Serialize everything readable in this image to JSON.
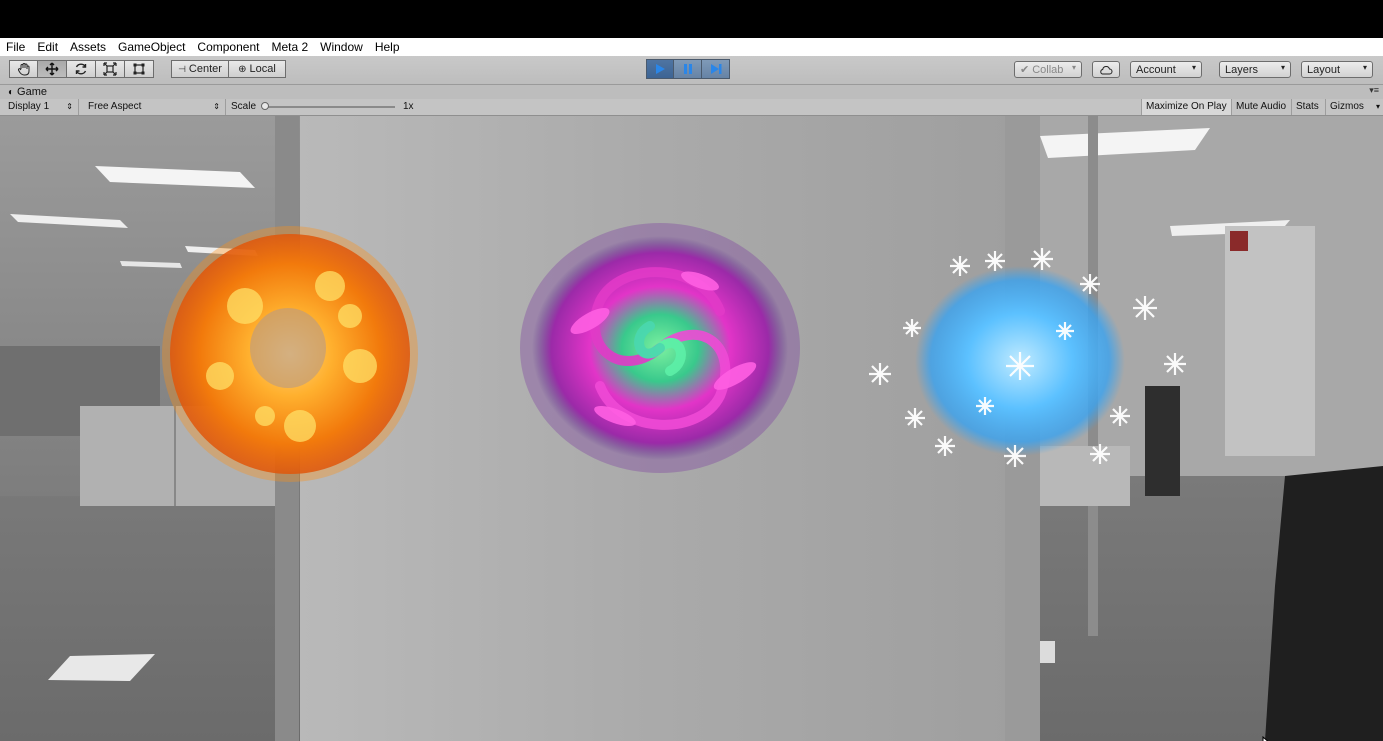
{
  "menu": [
    "File",
    "Edit",
    "Assets",
    "GameObject",
    "Component",
    "Meta 2",
    "Window",
    "Help"
  ],
  "toolbar": {
    "transform_tools": [
      "hand-icon",
      "move-icon",
      "rotate-icon",
      "scale-icon",
      "rect-icon"
    ],
    "pivot_label": "Center",
    "space_label": "Local",
    "play_controls": [
      "play-icon",
      "pause-icon",
      "step-icon"
    ],
    "collab_label": "Collab",
    "cloud_icon": "cloud-icon",
    "account_label": "Account",
    "layers_label": "Layers",
    "layout_label": "Layout"
  },
  "game_tab": {
    "icon": "game-controller-icon",
    "label": "Game"
  },
  "game_controls": {
    "display_label": "Display 1",
    "aspect_label": "Free Aspect",
    "scale_label": "Scale",
    "scale_value_label": "1x",
    "scale_value": 1,
    "maximize_label": "Maximize On Play",
    "mute_label": "Mute Audio",
    "stats_label": "Stats",
    "gizmos_label": "Gizmos"
  },
  "scene": {
    "objects": [
      "fire-sphere",
      "vortex-portal",
      "snowflake-orb"
    ]
  },
  "colors": {
    "play_active": "#4f74a2",
    "fire": "#ff9a1a",
    "vortex": "#d02fb8",
    "ice": "#5bc3ff"
  }
}
